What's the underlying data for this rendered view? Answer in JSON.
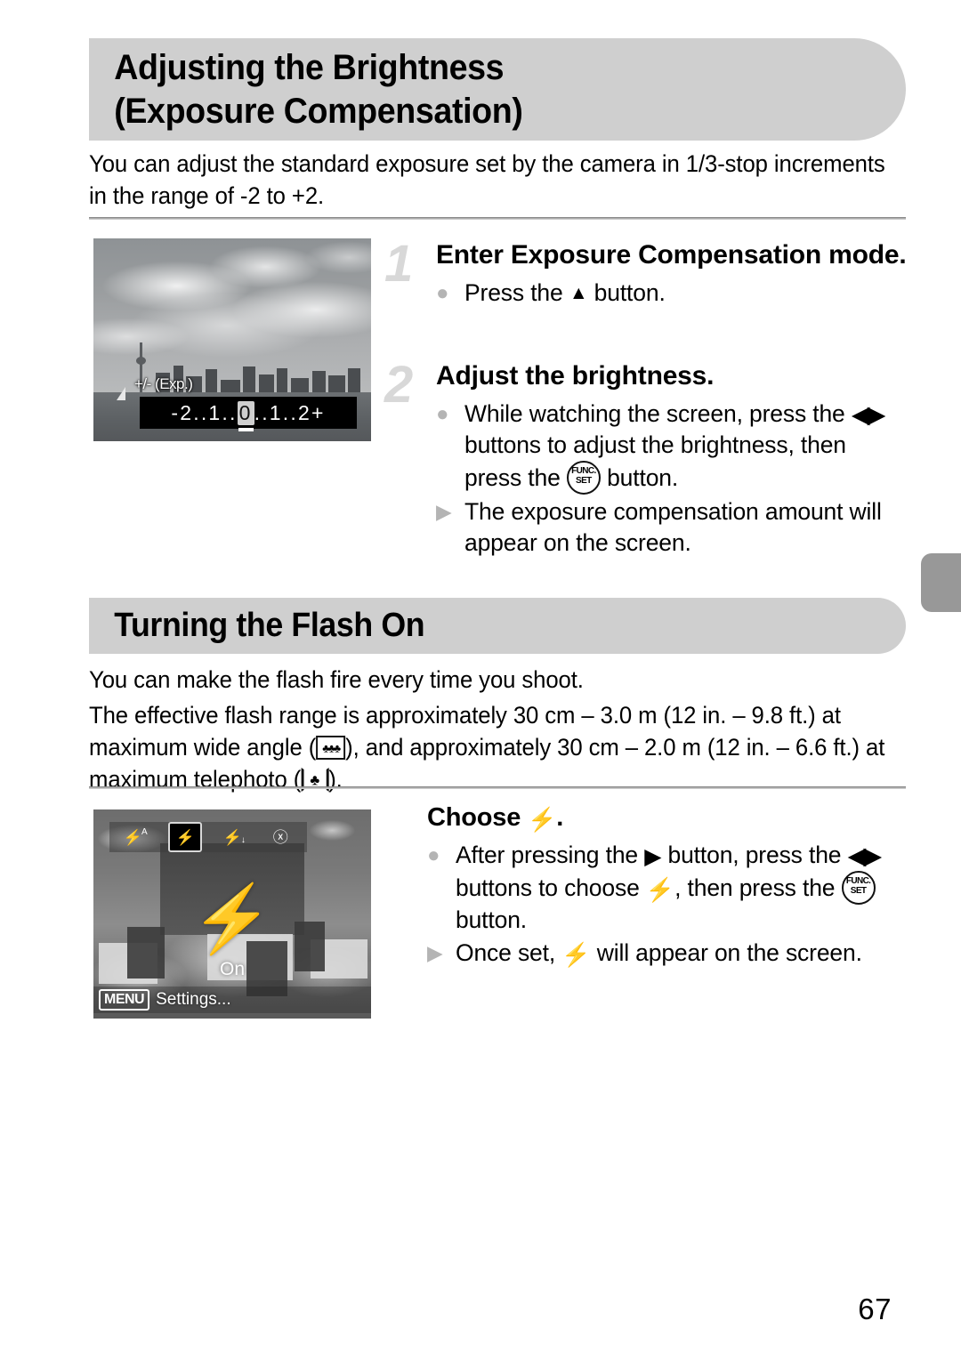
{
  "page": {
    "number": "67"
  },
  "sections": [
    {
      "id": "exposure",
      "banner_title": "Adjusting the Brightness\n(Exposure Compensation)",
      "intro": "You can adjust the standard exposure set by the camera in 1/3-stop increments in the range of -2 to +2."
    },
    {
      "id": "flash",
      "banner_title": "Turning the Flash On",
      "intro_line1": "You can make the flash fire every time you shoot.",
      "intro_line2_a": "The effective flash range is approximately 30 cm – 3.0 m (12 in. – 9.8 ft.) at maximum wide angle (",
      "intro_line2_b": "), and approximately 30 cm – 2.0 m (12 in. – 6.6 ft.) at maximum telephoto (",
      "intro_line2_c": ")."
    }
  ],
  "steps": [
    {
      "number": "1",
      "title": "Enter Exposure Compensation mode.",
      "bullets": [
        {
          "marker": "dot",
          "text_a": "Press the ",
          "icon": "up-arrow-icon",
          "text_b": " button."
        }
      ]
    },
    {
      "number": "2",
      "title": "Adjust the brightness.",
      "bullets": [
        {
          "marker": "dot",
          "text_a": "While watching the screen, press the ",
          "icon": "left-right-arrows-icon",
          "text_b": " buttons to adjust the brightness, then press the ",
          "icon2": "func-set-icon",
          "text_c": " button."
        },
        {
          "marker": "triangle",
          "text_a": "The exposure compensation amount will appear on the screen."
        }
      ]
    },
    {
      "number": "",
      "title_a": "Choose ",
      "title_icon": "flash-on-icon",
      "title_b": ".",
      "bullets": [
        {
          "marker": "dot",
          "text_a": "After pressing the ",
          "icon": "right-arrow-icon",
          "text_b": " button, press the ",
          "icon2": "left-right-arrows-icon",
          "text_c": " buttons to choose ",
          "icon3": "flash-on-icon",
          "text_d": ", then press the ",
          "icon4": "func-set-icon",
          "text_e": " button."
        },
        {
          "marker": "triangle",
          "text_a": "Once set, ",
          "icon": "flash-on-icon",
          "text_b": " will appear on the screen."
        }
      ]
    }
  ],
  "screenshots": {
    "exposure_screen": {
      "name": "cityscape-exposure-screen",
      "overlay_label": "+/- (Exp.)",
      "scale_left": "-2..1..",
      "scale_zero": "0",
      "scale_right": "..1..2+"
    },
    "flash_screen": {
      "name": "restaurant-flash-menu-screen",
      "menu_items": [
        {
          "name": "flash-auto-icon",
          "glyph": "⚡",
          "sup": "A",
          "sub": "",
          "selected": false
        },
        {
          "name": "flash-on-icon",
          "glyph": "⚡",
          "sup": "",
          "sub": "",
          "selected": true
        },
        {
          "name": "flash-slow-sync-icon",
          "glyph": "⚡",
          "sup": "",
          "sub": "↓",
          "selected": false
        },
        {
          "name": "flash-off-icon",
          "glyph": "ⓧ",
          "sup": "",
          "sub": "",
          "selected": false
        }
      ],
      "status_label": "On",
      "menu_key": "MENU",
      "menu_text": "Settings..."
    }
  },
  "glyphs": {
    "up_arrow": "▲",
    "right_arrow": "▶",
    "left_right": "◀▶",
    "flash": "⚡",
    "func": "FUNC.",
    "set": "SET",
    "wide": "♣♣♣",
    "tele": "♣",
    "bullet_dot": "●",
    "bullet_tri": "▶"
  },
  "colors": {
    "banner_bg": "#cfcfcf",
    "step_number": "#d8d8d8",
    "bullet": "#b4b4b4",
    "rule": "#8b8b8b",
    "edge_tab": "#989898"
  }
}
